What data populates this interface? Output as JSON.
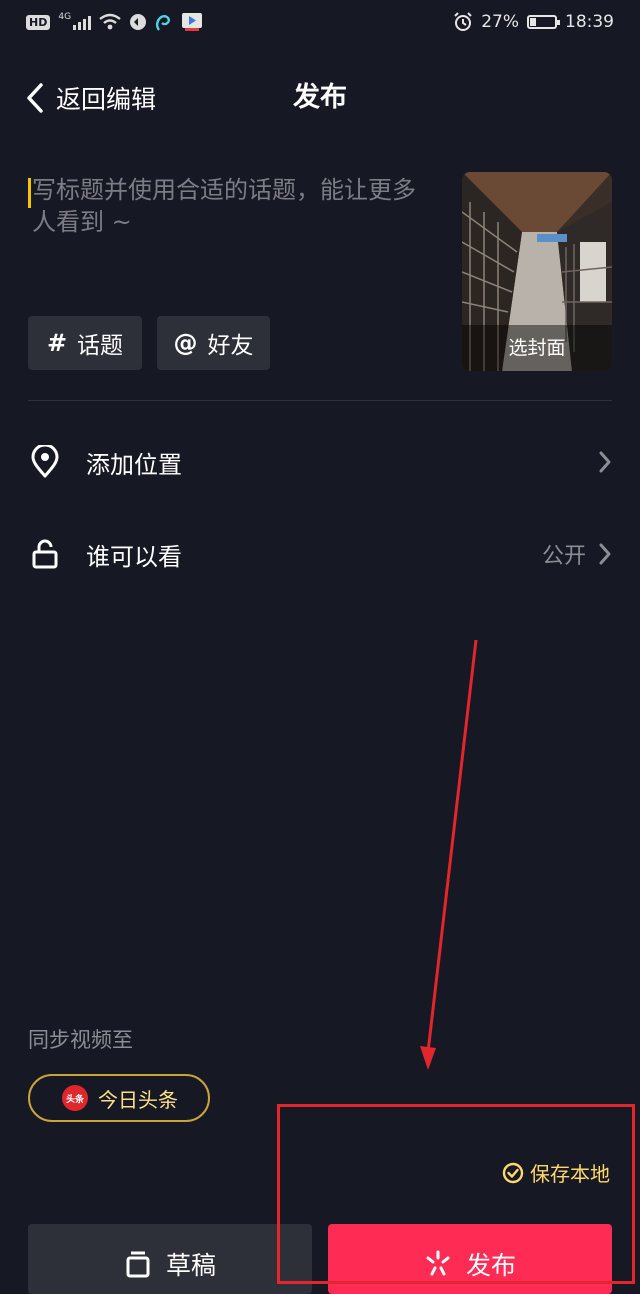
{
  "status_bar": {
    "left_badges": [
      "HD",
      "4G"
    ],
    "battery_percent": "27%",
    "battery_level": 0.27,
    "time": "18:39"
  },
  "header": {
    "back_label": "返回编辑",
    "title": "发布"
  },
  "caption": {
    "placeholder": "写标题并使用合适的话题，能让更多人看到 ~",
    "value": ""
  },
  "cover": {
    "label": "选封面"
  },
  "chips": [
    {
      "icon": "#",
      "label": "话题"
    },
    {
      "icon": "@",
      "label": "好友"
    }
  ],
  "settings": {
    "location": {
      "label": "添加位置",
      "value": ""
    },
    "privacy": {
      "label": "谁可以看",
      "value": "公开"
    }
  },
  "sync": {
    "label": "同步视频至",
    "platform_logo": "头条",
    "platform_label": "今日头条"
  },
  "save_local": {
    "label": "保存本地",
    "checked": true
  },
  "buttons": {
    "draft": "草稿",
    "publish": "发布"
  },
  "colors": {
    "background": "#161823",
    "chip": "#2d2f39",
    "accent_yellow": "#f8c400",
    "publish_red": "#fe2c55",
    "annotation_red": "#e3262b"
  }
}
